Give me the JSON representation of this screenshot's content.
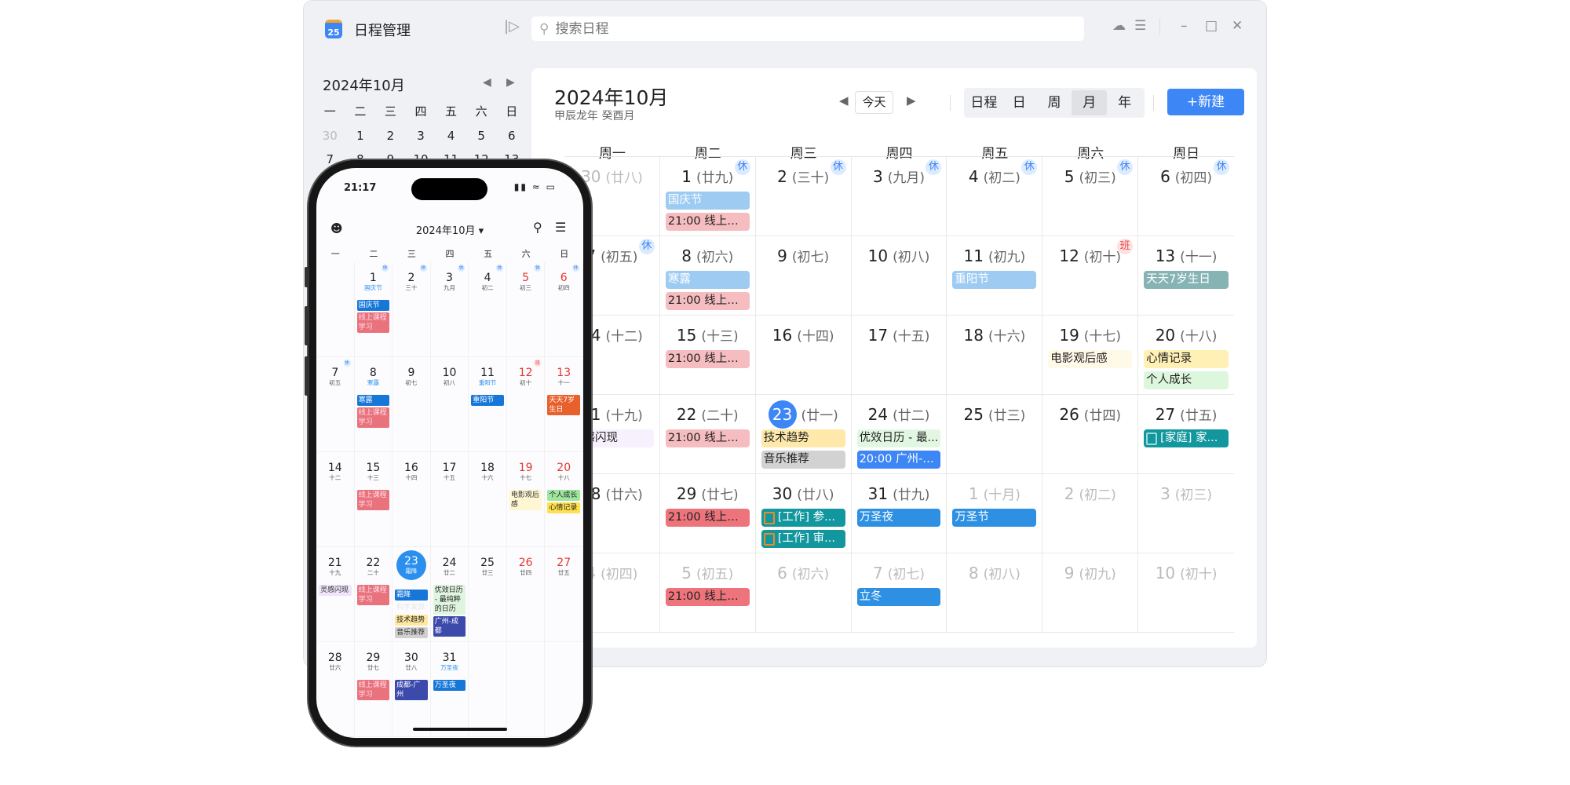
{
  "app": {
    "title": "日程管理",
    "icon_text": "25",
    "search_placeholder": "搜索日程"
  },
  "sidebar": {
    "title": "2024年10月",
    "weekdays": [
      "一",
      "二",
      "三",
      "四",
      "五",
      "六",
      "日"
    ],
    "days": [
      {
        "d": "30",
        "grey": true
      },
      {
        "d": "1"
      },
      {
        "d": "2"
      },
      {
        "d": "3"
      },
      {
        "d": "4"
      },
      {
        "d": "5"
      },
      {
        "d": "6"
      },
      {
        "d": "7"
      },
      {
        "d": "8"
      },
      {
        "d": "9"
      },
      {
        "d": "10"
      },
      {
        "d": "11"
      },
      {
        "d": "12"
      },
      {
        "d": "13"
      }
    ]
  },
  "main": {
    "title": "2024年10月",
    "subtitle": "甲辰龙年 癸酉月",
    "today_label": "今天",
    "views": [
      "日程",
      "日",
      "周",
      "月",
      "年"
    ],
    "active_view": "月",
    "new_label": "+新建",
    "weekdays": [
      "周一",
      "周二",
      "周三",
      "周四",
      "周五",
      "周六",
      "周日"
    ]
  },
  "colors": {
    "accent": "#3d86f5",
    "rest_badge_bg": "#dcebff",
    "work_badge_bg": "#fde0e0",
    "work_badge": "#e84a4a"
  },
  "cells": [
    {
      "d": "30",
      "l": "(廿八)",
      "o": true
    },
    {
      "d": "1",
      "l": "(廿九)",
      "b": "休",
      "e": [
        {
          "t": "国庆节",
          "bg": "#9ecbf2",
          "c": "#fff"
        },
        {
          "t": "21:00 线上课...",
          "bg": "#f6bdc1",
          "c": "#222"
        }
      ]
    },
    {
      "d": "2",
      "l": "(三十)",
      "b": "休"
    },
    {
      "d": "3",
      "l": "(九月)",
      "b": "休"
    },
    {
      "d": "4",
      "l": "(初二)",
      "b": "休"
    },
    {
      "d": "5",
      "l": "(初三)",
      "b": "休"
    },
    {
      "d": "6",
      "l": "(初四)",
      "b": "休"
    },
    {
      "d": "7",
      "l": "(初五)",
      "b": "休"
    },
    {
      "d": "8",
      "l": "(初六)",
      "e": [
        {
          "t": "寒露",
          "bg": "#9ecbf2",
          "c": "#fff"
        },
        {
          "t": "21:00 线上课...",
          "bg": "#f6bdc1",
          "c": "#222"
        }
      ]
    },
    {
      "d": "9",
      "l": "(初七)"
    },
    {
      "d": "10",
      "l": "(初八)"
    },
    {
      "d": "11",
      "l": "(初九)",
      "e": [
        {
          "t": "重阳节",
          "bg": "#9ecbf2",
          "c": "#fff"
        }
      ]
    },
    {
      "d": "12",
      "l": "(初十)",
      "b": "班"
    },
    {
      "d": "13",
      "l": "(十一)",
      "e": [
        {
          "t": "天天7岁生日",
          "bg": "#86b4b4",
          "c": "#fff"
        }
      ]
    },
    {
      "d": "14",
      "l": "(十二)"
    },
    {
      "d": "15",
      "l": "(十三)",
      "e": [
        {
          "t": "21:00 线上课...",
          "bg": "#f6bdc1",
          "c": "#222"
        }
      ]
    },
    {
      "d": "16",
      "l": "(十四)"
    },
    {
      "d": "17",
      "l": "(十五)"
    },
    {
      "d": "18",
      "l": "(十六)"
    },
    {
      "d": "19",
      "l": "(十七)",
      "e": [
        {
          "t": "电影观后感",
          "bg": "#fff9e8",
          "c": "#222"
        }
      ]
    },
    {
      "d": "20",
      "l": "(十八)",
      "e": [
        {
          "t": "心情记录",
          "bg": "#fff0b5",
          "c": "#222"
        },
        {
          "t": "个人成长",
          "bg": "#ddf7dd",
          "c": "#222"
        }
      ]
    },
    {
      "d": "21",
      "l": "(十九)",
      "e": [
        {
          "t": "灵感闪现",
          "bg": "#f6f1fc",
          "c": "#222"
        }
      ]
    },
    {
      "d": "22",
      "l": "(二十)",
      "e": [
        {
          "t": "21:00 线上课...",
          "bg": "#f6bdc1",
          "c": "#222"
        }
      ]
    },
    {
      "d": "23",
      "l": "(廿一)",
      "today": true,
      "e": [
        {
          "t": "技术趋势",
          "bg": "#ffe9aa",
          "c": "#222"
        },
        {
          "t": "音乐推荐",
          "bg": "#d2d2d2",
          "c": "#222"
        }
      ]
    },
    {
      "d": "24",
      "l": "(廿二)",
      "e": [
        {
          "t": "优效日历 - 最...",
          "bg": "#e2f7e2",
          "c": "#222"
        },
        {
          "t": "20:00 广州-成都",
          "bg": "#3d86f5",
          "c": "#fff"
        }
      ]
    },
    {
      "d": "25",
      "l": "(廿三)"
    },
    {
      "d": "26",
      "l": "(廿四)"
    },
    {
      "d": "27",
      "l": "(廿五)",
      "e": [
        {
          "t": "[家庭] 家...",
          "bg": "#12979e",
          "c": "#fff",
          "cb": "#9fd8db"
        }
      ]
    },
    {
      "d": "28",
      "l": "(廿六)"
    },
    {
      "d": "29",
      "l": "(廿七)",
      "e": [
        {
          "t": "21:00 线上课...",
          "bg": "#ee747c",
          "c": "#222"
        }
      ]
    },
    {
      "d": "30",
      "l": "(廿八)",
      "e": [
        {
          "t": "[工作] 参...",
          "bg": "#12979e",
          "c": "#fff",
          "cb": "#f08a24"
        },
        {
          "t": "[工作] 审...",
          "bg": "#12979e",
          "c": "#fff",
          "cb": "#f08a24"
        }
      ]
    },
    {
      "d": "31",
      "l": "(廿九)",
      "e": [
        {
          "t": "万圣夜",
          "bg": "#2e90e2",
          "c": "#fff"
        }
      ]
    },
    {
      "d": "1",
      "l": "(十月)",
      "o": true,
      "e": [
        {
          "t": "万圣节",
          "bg": "#2e90e2",
          "c": "#fff"
        }
      ]
    },
    {
      "d": "2",
      "l": "(初二)",
      "o": true
    },
    {
      "d": "3",
      "l": "(初三)",
      "o": true
    },
    {
      "d": "4",
      "l": "(初四)",
      "o": true
    },
    {
      "d": "5",
      "l": "(初五)",
      "o": true,
      "e": [
        {
          "t": "21:00 线上课...",
          "bg": "#ee747c",
          "c": "#222"
        }
      ]
    },
    {
      "d": "6",
      "l": "(初六)",
      "o": true
    },
    {
      "d": "7",
      "l": "(初七)",
      "o": true,
      "e": [
        {
          "t": "立冬",
          "bg": "#2e90e2",
          "c": "#fff"
        }
      ]
    },
    {
      "d": "8",
      "l": "(初八)",
      "o": true
    },
    {
      "d": "9",
      "l": "(初九)",
      "o": true
    },
    {
      "d": "10",
      "l": "(初十)",
      "o": true
    }
  ],
  "phone": {
    "time": "21:17",
    "title": "2024年10月 ▾",
    "weekdays": [
      "一",
      "二",
      "三",
      "四",
      "五",
      "六",
      "日"
    ],
    "cells": [
      {},
      {
        "d": "1",
        "l": "国庆节",
        "lb": true,
        "b": "休",
        "e": [
          {
            "t": "国庆节",
            "bg": "#1677d9",
            "c": "#fff"
          },
          {
            "t": "线上课程学习",
            "bg": "#e9737c",
            "c": "#fde"
          }
        ]
      },
      {
        "d": "2",
        "l": "三十",
        "b": "休"
      },
      {
        "d": "3",
        "l": "九月",
        "b": "休"
      },
      {
        "d": "4",
        "l": "初二",
        "b": "休"
      },
      {
        "d": "5",
        "l": "初三",
        "b": "休",
        "r": true
      },
      {
        "d": "6",
        "l": "初四",
        "b": "休",
        "r": true
      },
      {
        "d": "7",
        "l": "初五",
        "b": "休"
      },
      {
        "d": "8",
        "l": "寒露",
        "lb": true,
        "e": [
          {
            "t": "寒露",
            "bg": "#1677d9",
            "c": "#fff"
          },
          {
            "t": "线上课程学习",
            "bg": "#e9737c",
            "c": "#fde"
          }
        ]
      },
      {
        "d": "9",
        "l": "初七"
      },
      {
        "d": "10",
        "l": "初八"
      },
      {
        "d": "11",
        "l": "重阳节",
        "lb": true,
        "e": [
          {
            "t": "重阳节",
            "bg": "#1677d9",
            "c": "#fff"
          }
        ]
      },
      {
        "d": "12",
        "l": "初十",
        "b": "班",
        "r": true
      },
      {
        "d": "13",
        "l": "十一",
        "r": true,
        "e": [
          {
            "t": "天天7岁生日",
            "bg": "#e8602c",
            "c": "#fff"
          }
        ]
      },
      {
        "d": "14",
        "l": "十二"
      },
      {
        "d": "15",
        "l": "十三",
        "e": [
          {
            "t": "线上课程学习",
            "bg": "#e9737c",
            "c": "#fde"
          }
        ]
      },
      {
        "d": "16",
        "l": "十四"
      },
      {
        "d": "17",
        "l": "十五"
      },
      {
        "d": "18",
        "l": "十六"
      },
      {
        "d": "19",
        "l": "十七",
        "r": true,
        "e": [
          {
            "t": "电影观后感",
            "bg": "#fff6d2",
            "c": "#333"
          }
        ]
      },
      {
        "d": "20",
        "l": "十八",
        "r": true,
        "e": [
          {
            "t": "个人成长",
            "bg": "#9ee69e",
            "c": "#222"
          },
          {
            "t": "心情记录",
            "bg": "#ffe14d",
            "c": "#222"
          }
        ]
      },
      {
        "d": "21",
        "l": "十九",
        "e": [
          {
            "t": "灵感闪现",
            "bg": "#efe4fb",
            "c": "#333"
          }
        ]
      },
      {
        "d": "22",
        "l": "二十",
        "e": [
          {
            "t": "线上课程学习",
            "bg": "#e9737c",
            "c": "#fde"
          }
        ]
      },
      {
        "d": "23",
        "l": "霜降",
        "today": true,
        "e": [
          {
            "t": "霜降",
            "bg": "#1677d9",
            "c": "#fff"
          },
          {
            "t": "科学发现",
            "bg": "transparent",
            "c": "#e6e6e6"
          },
          {
            "t": "技术趋势",
            "bg": "#ffe9a0",
            "c": "#222"
          },
          {
            "t": "音乐推荐",
            "bg": "#d0d0d0",
            "c": "#333"
          }
        ]
      },
      {
        "d": "24",
        "l": "廿二",
        "e": [
          {
            "t": "优效日历 - 最纯粹的日历",
            "bg": "#e0f5e0",
            "c": "#222"
          },
          {
            "t": "广州-成都",
            "bg": "#3c4bab",
            "c": "#fff"
          }
        ]
      },
      {
        "d": "25",
        "l": "廿三"
      },
      {
        "d": "26",
        "l": "廿四",
        "r": true
      },
      {
        "d": "27",
        "l": "廿五",
        "r": true
      },
      {
        "d": "28",
        "l": "廿六"
      },
      {
        "d": "29",
        "l": "廿七",
        "e": [
          {
            "t": "线上课程学习",
            "bg": "#e9737c",
            "c": "#fde"
          }
        ]
      },
      {
        "d": "30",
        "l": "廿八",
        "e": [
          {
            "t": "成都-广州",
            "bg": "#3c4bab",
            "c": "#fff"
          }
        ]
      },
      {
        "d": "31",
        "l": "万圣夜",
        "lb": true,
        "e": [
          {
            "t": "万圣夜",
            "bg": "#1677d9",
            "c": "#fff"
          }
        ]
      },
      {},
      {},
      {}
    ]
  }
}
